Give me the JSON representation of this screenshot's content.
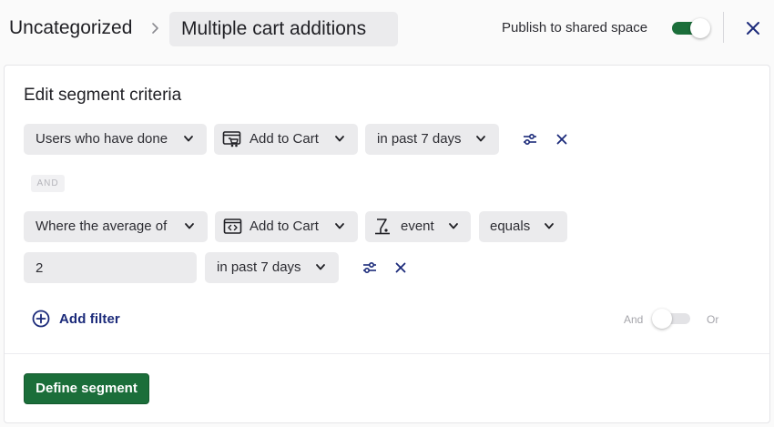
{
  "header": {
    "breadcrumb_root": "Uncategorized",
    "title": "Multiple cart additions",
    "publish_label": "Publish to shared space",
    "publish_enabled": true
  },
  "card": {
    "title": "Edit segment criteria",
    "condition_1": {
      "scope": "Users who have done",
      "event": "Add to Cart",
      "event_icon": "cart-screen-icon",
      "timeframe": "in past 7 days"
    },
    "joiner": "AND",
    "condition_2": {
      "scope": "Where the average of",
      "event": "Add to Cart",
      "event_icon": "code-screen-icon",
      "property": "event",
      "property_icon": "property-pin-icon",
      "operator": "equals",
      "value": "2",
      "timeframe": "in past 7 days"
    },
    "add_filter_label": "Add filter",
    "and_label": "And",
    "or_label": "Or",
    "logic_or_enabled": false,
    "define_button": "Define segment"
  },
  "colors": {
    "accent_green": "#1b6e3a",
    "link_navy": "#1b2a7a",
    "chip_bg": "#ebebed"
  }
}
